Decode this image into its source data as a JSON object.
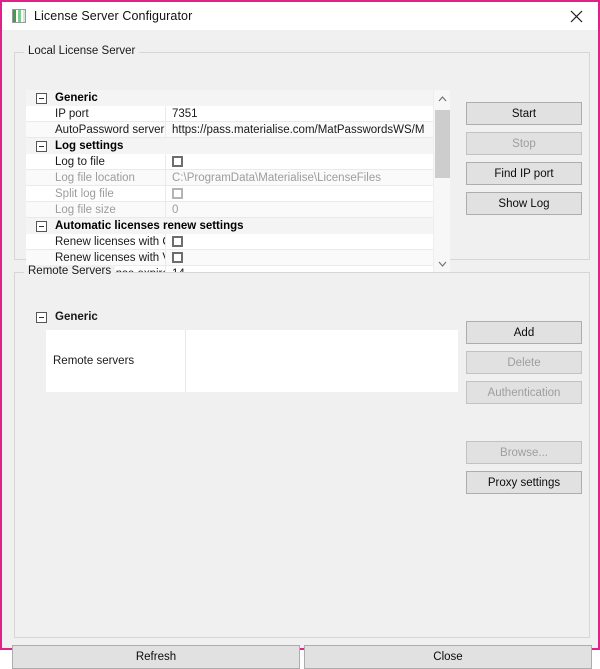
{
  "window": {
    "title": "License Server Configurator",
    "icon": "app-window-icon",
    "close_icon": "close-icon",
    "border_color": "#e0218a"
  },
  "local_group": {
    "legend": "Local License Server",
    "grid": {
      "categories": [
        {
          "label": "Generic",
          "expanded": true,
          "rows": [
            {
              "name": "IP port",
              "value": "7351",
              "type": "text",
              "disabled": false
            },
            {
              "name": "AutoPassword server URL",
              "value": "https://pass.materialise.com/MatPasswordsWS/M",
              "type": "text",
              "disabled": false
            }
          ]
        },
        {
          "label": "Log settings",
          "expanded": true,
          "rows": [
            {
              "name": "Log to file",
              "value": "",
              "type": "checkbox",
              "checked": false,
              "disabled": false
            },
            {
              "name": "Log file location",
              "value": "C:\\ProgramData\\Materialise\\LicenseFiles",
              "type": "text",
              "disabled": true
            },
            {
              "name": "Split log file",
              "value": "",
              "type": "checkbox",
              "checked": false,
              "disabled": true
            },
            {
              "name": "Log file size",
              "value": "0",
              "type": "text",
              "disabled": true
            }
          ]
        },
        {
          "label": "Automatic licenses renew settings",
          "expanded": true,
          "rows": [
            {
              "name": "Renew licenses with CC-key",
              "value": "",
              "type": "checkbox",
              "checked": false,
              "disabled": false
            },
            {
              "name": "Renew licenses with Vouch...",
              "value": "",
              "type": "checkbox",
              "checked": false,
              "disabled": false
            },
            {
              "name": "Days till license expired",
              "value": "14",
              "type": "text",
              "disabled": false
            }
          ]
        }
      ],
      "scrollbar": {
        "up_icon": "chevron-up-icon",
        "down_icon": "chevron-down-icon"
      }
    },
    "buttons": [
      {
        "label": "Start",
        "disabled": false
      },
      {
        "label": "Stop",
        "disabled": true
      },
      {
        "label": "Find IP port",
        "disabled": false
      },
      {
        "label": "Show Log",
        "disabled": false
      }
    ]
  },
  "remote_group": {
    "legend": "Remote Servers",
    "category": "Generic",
    "row": {
      "name": "Remote servers",
      "value": ""
    },
    "buttons": [
      {
        "label": "Add",
        "disabled": false
      },
      {
        "label": "Delete",
        "disabled": true
      },
      {
        "label": "Authentication",
        "disabled": true
      },
      {
        "label": "Browse...",
        "disabled": true
      },
      {
        "label": "Proxy settings",
        "disabled": false
      }
    ]
  },
  "footer": {
    "refresh_label": "Refresh",
    "close_label": "Close"
  }
}
